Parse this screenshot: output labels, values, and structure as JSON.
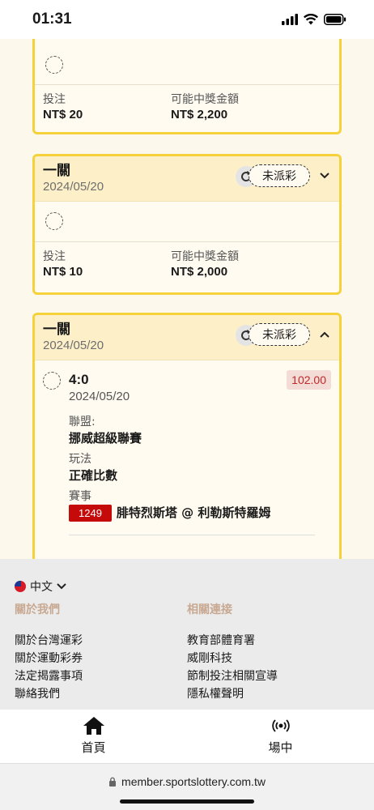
{
  "status_bar": {
    "time": "01:31"
  },
  "cards": [
    {
      "selection_icon": "dashed-circle-icon",
      "stake_label": "投注",
      "stake_value": "NT$ 20",
      "payout_label": "可能中獎金額",
      "payout_value": "NT$ 2,200"
    },
    {
      "title": "一關",
      "date": "2024/05/20",
      "status": "未派彩",
      "expanded": false,
      "stake_label": "投注",
      "stake_value": "NT$ 10",
      "payout_label": "可能中獎金額",
      "payout_value": "NT$ 2,000"
    },
    {
      "title": "一關",
      "date": "2024/05/20",
      "status": "未派彩",
      "expanded": true,
      "score": "4:0",
      "match_date": "2024/05/20",
      "odds": "102.00",
      "league_label": "聯盟:",
      "league_value": "挪威超級聯賽",
      "play_label": "玩法",
      "play_value": "正確比數",
      "event_label": "賽事",
      "event_id": "1249",
      "event_name": "腓特烈斯塔 @ 利勒斯特羅姆"
    }
  ],
  "footer": {
    "language": "中文",
    "about_heading": "關於我們",
    "about_links": [
      "關於台灣運彩",
      "關於運動彩券",
      "法定揭露事項",
      "聯絡我們"
    ],
    "links_heading": "相關連接",
    "related_links": [
      "教育部體育署",
      "威剛科技",
      "節制投注相關宣導",
      "隱私權聲明"
    ]
  },
  "tab_bar": {
    "home_label": "首頁",
    "live_label": "場中"
  },
  "browser": {
    "url": "member.sportslottery.com.tw"
  },
  "colors": {
    "accent_border": "#f5d23c",
    "header_bg": "#fdf0c8",
    "event_badge": "#c50a0a",
    "odds_text": "#c0282a"
  }
}
